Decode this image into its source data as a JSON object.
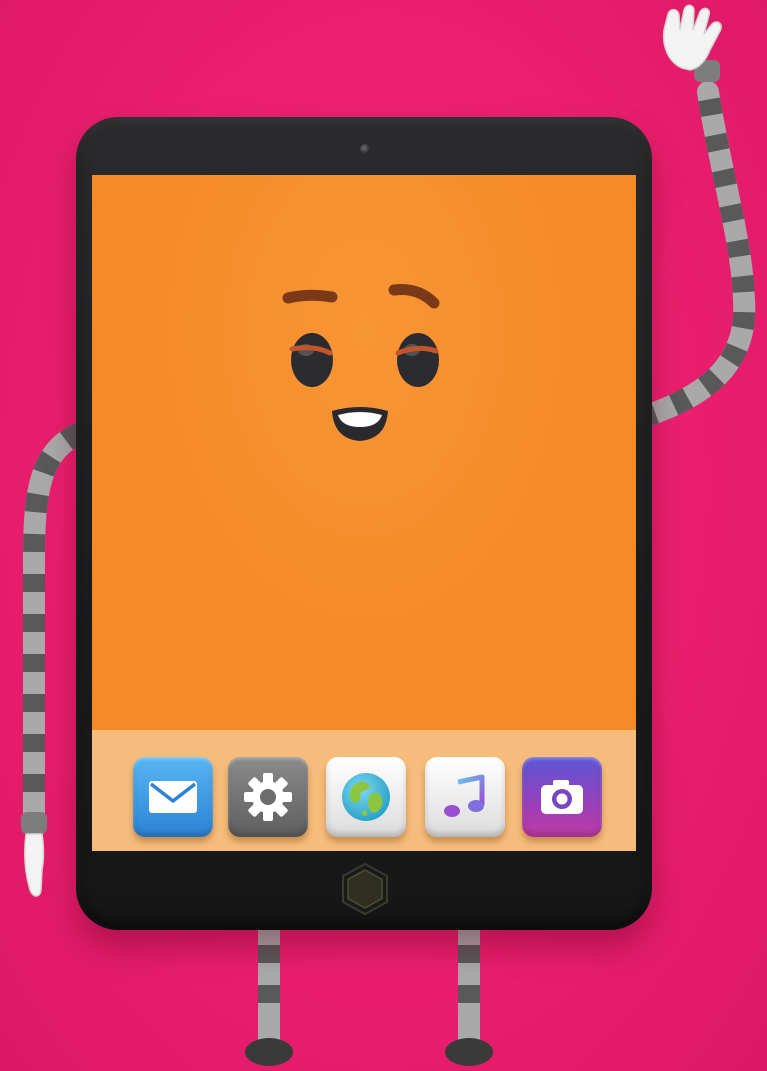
{
  "scene": {
    "character": "tablet-character",
    "expression": "smiling",
    "gesture": "waving"
  },
  "colors": {
    "background": "#ea1f6e",
    "screen": "#f58a27",
    "dock": "#f6bc7b",
    "bezel": "#1f1f21",
    "limb_light": "#a8a8a8",
    "limb_dark": "#5c5c5c"
  },
  "dock": {
    "apps": [
      {
        "name": "mail",
        "icon": "envelope-icon",
        "color": "#2c82d6"
      },
      {
        "name": "settings",
        "icon": "gear-icon",
        "color": "#6d6d6d"
      },
      {
        "name": "browser",
        "icon": "globe-icon",
        "color": "#ececec"
      },
      {
        "name": "music",
        "icon": "music-note-icon",
        "color": "#ececec"
      },
      {
        "name": "camera",
        "icon": "camera-icon",
        "color": "#8a48c8"
      }
    ]
  }
}
